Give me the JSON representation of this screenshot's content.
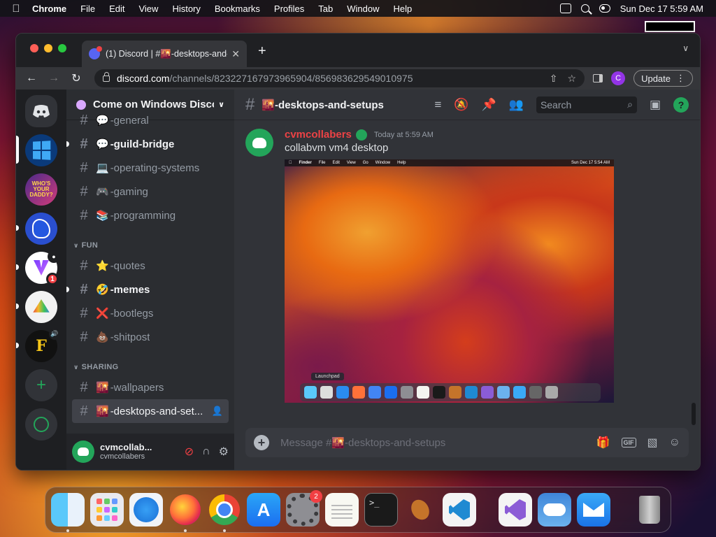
{
  "menubar": {
    "app": "Chrome",
    "items": [
      "File",
      "Edit",
      "View",
      "History",
      "Bookmarks",
      "Profiles",
      "Tab",
      "Window",
      "Help"
    ],
    "datetime": "Sun Dec 17  5:59 AM"
  },
  "browser": {
    "tab_title": "(1) Discord | #🌇-desktops-and-setups",
    "new_tab": "+",
    "url_domain": "discord.com",
    "url_path": "/channels/823227167973965904/856983629549010975",
    "profile_initial": "C",
    "update_label": "Update"
  },
  "guilds": {
    "cam_badge": "●",
    "unread_count": "1",
    "speaker_glyph": "🔊",
    "daddy_text": "WHO'S YOUR DADDY?",
    "f_letter": "F",
    "add_glyph": "+"
  },
  "server": {
    "name": "Come on Windows Discord"
  },
  "channels": {
    "top": [
      {
        "emoji": "💬",
        "name": "-general",
        "unread": false
      },
      {
        "emoji": "💬",
        "name": "-guild-bridge",
        "unread": true
      },
      {
        "emoji": "💻",
        "name": "-operating-systems",
        "unread": false
      },
      {
        "emoji": "🎮",
        "name": "-gaming",
        "unread": false
      },
      {
        "emoji": "📚",
        "name": "-programming",
        "unread": false
      }
    ],
    "fun_label": "FUN",
    "fun": [
      {
        "emoji": "⭐",
        "name": "-quotes",
        "unread": false
      },
      {
        "emoji": "🤣",
        "name": "-memes",
        "unread": true
      },
      {
        "emoji": "❌",
        "name": "-bootlegs",
        "unread": false
      },
      {
        "emoji": "💩",
        "name": "-shitpost",
        "unread": false
      }
    ],
    "sharing_label": "SHARING",
    "sharing": [
      {
        "emoji": "🌇",
        "name": "-wallpapers",
        "unread": false
      },
      {
        "emoji": "🌇",
        "name": "-desktops-and-set...",
        "unread": false
      }
    ]
  },
  "user": {
    "display_name": "cvmcollab...",
    "username": "cvmcollabers"
  },
  "chat": {
    "channel_title": "🌇-desktops-and-setups",
    "search_placeholder": "Search",
    "help_glyph": "?",
    "message": {
      "author": "cvmcollabers",
      "timestamp": "Today at 5:59 AM",
      "text": "collabvm vm4 desktop"
    },
    "attachment": {
      "menu_items": [
        "Finder",
        "File",
        "Edit",
        "View",
        "Go",
        "Window",
        "Help"
      ],
      "menu_clock": "Sun Dec 17  5:54 AM",
      "tooltip": "Launchpad"
    },
    "composer_placeholder": "Message #🌇-desktops-and-setups",
    "gif_label": "GIF"
  },
  "dock": {
    "settings_badge": "2",
    "terminal_prompt": ">_"
  }
}
